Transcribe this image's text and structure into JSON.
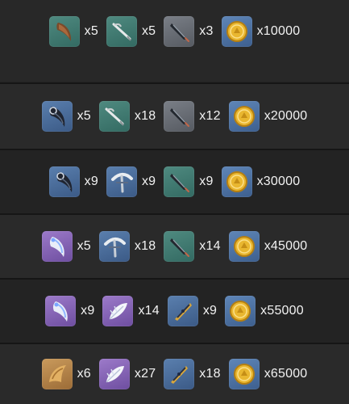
{
  "rows": [
    {
      "items": [
        {
          "icon": "brown-claw-icon",
          "rarity": "green",
          "qty": "x5"
        },
        {
          "icon": "bone-blade-icon",
          "rarity": "green",
          "qty": "x5"
        },
        {
          "icon": "dark-fang-icon",
          "rarity": "gray",
          "qty": "x3"
        },
        {
          "icon": "gold-coin-icon",
          "rarity": "coin",
          "qty": "x10000"
        }
      ]
    },
    {
      "items": [
        {
          "icon": "black-claw-icon",
          "rarity": "blue",
          "qty": "x5"
        },
        {
          "icon": "bone-blade-icon",
          "rarity": "green",
          "qty": "x18"
        },
        {
          "icon": "dark-fang-icon",
          "rarity": "gray",
          "qty": "x12"
        },
        {
          "icon": "gold-coin-icon",
          "rarity": "coin",
          "qty": "x20000"
        }
      ]
    },
    {
      "items": [
        {
          "icon": "black-claw-icon",
          "rarity": "blue",
          "qty": "x9"
        },
        {
          "icon": "bone-horn-icon",
          "rarity": "blue",
          "qty": "x9"
        },
        {
          "icon": "dark-fang-icon",
          "rarity": "green",
          "qty": "x9"
        },
        {
          "icon": "gold-coin-icon",
          "rarity": "coin",
          "qty": "x30000"
        }
      ]
    },
    {
      "items": [
        {
          "icon": "silver-claw-icon",
          "rarity": "purple",
          "qty": "x5"
        },
        {
          "icon": "bone-horn-icon",
          "rarity": "blue",
          "qty": "x18"
        },
        {
          "icon": "dark-fang-icon",
          "rarity": "green",
          "qty": "x14"
        },
        {
          "icon": "gold-coin-icon",
          "rarity": "coin",
          "qty": "x45000"
        }
      ]
    },
    {
      "items": [
        {
          "icon": "silver-claw-icon",
          "rarity": "purple",
          "qty": "x9"
        },
        {
          "icon": "white-feather-icon",
          "rarity": "purple",
          "qty": "x14"
        },
        {
          "icon": "golden-fang-icon",
          "rarity": "blue",
          "qty": "x9"
        },
        {
          "icon": "gold-coin-icon",
          "rarity": "coin",
          "qty": "x55000"
        }
      ]
    },
    {
      "items": [
        {
          "icon": "golden-horn-icon",
          "rarity": "gold",
          "qty": "x6"
        },
        {
          "icon": "white-feather-icon",
          "rarity": "purple",
          "qty": "x27"
        },
        {
          "icon": "golden-fang-icon",
          "rarity": "blue",
          "qty": "x18"
        },
        {
          "icon": "gold-coin-icon",
          "rarity": "coin",
          "qty": "x65000"
        }
      ]
    }
  ]
}
